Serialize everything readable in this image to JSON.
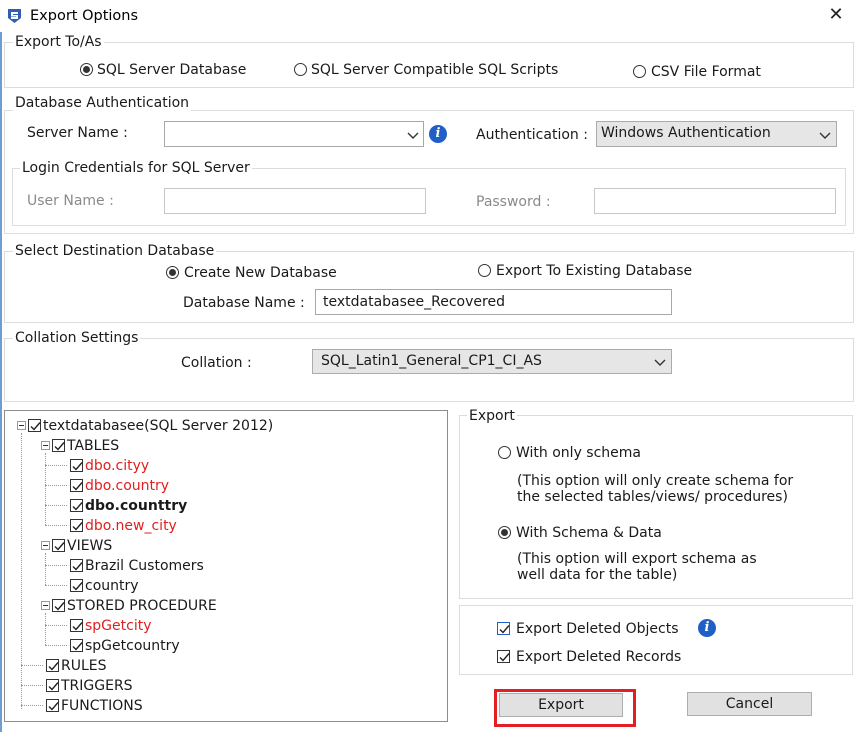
{
  "window": {
    "title": "Export Options"
  },
  "export_to": {
    "legend": "Export To/As",
    "options": [
      "SQL Server Database",
      "SQL Server Compatible SQL Scripts",
      "CSV File Format"
    ],
    "selected": 0
  },
  "auth": {
    "legend": "Database Authentication",
    "server_name_label": "Server Name :",
    "server_name_value": "",
    "authentication_label": "Authentication :",
    "authentication_value": "Windows Authentication",
    "login": {
      "legend": "Login Credentials for SQL Server",
      "user_name_label": "User Name :",
      "password_label": "Password :"
    }
  },
  "destination": {
    "legend": "Select Destination Database",
    "options": [
      "Create New Database",
      "Export To Existing Database"
    ],
    "selected": 0,
    "db_name_label": "Database Name :",
    "db_name_value": "textdatabasee_Recovered"
  },
  "collation": {
    "legend": "Collation Settings",
    "label": "Collation :",
    "value": "SQL_Latin1_General_CP1_CI_AS"
  },
  "tree": {
    "root": "textdatabasee(SQL Server 2012)",
    "tables": "TABLES",
    "table_items": [
      "dbo.cityy",
      "dbo.country",
      "dbo.counttry",
      "dbo.new_city"
    ],
    "views": "VIEWS",
    "view_items": [
      "Brazil Customers",
      "country"
    ],
    "procs": "STORED PROCEDURE",
    "proc_items": [
      "spGetcity",
      "spGetcountry"
    ],
    "rules": "RULES",
    "triggers": "TRIGGERS",
    "functions": "FUNCTIONS",
    "highlight_color": "#e02020"
  },
  "export_panel": {
    "legend": "Export",
    "schema_only": "With only schema",
    "schema_only_desc1": "(This option will only create schema for",
    "schema_only_desc2": "the  selected tables/views/ procedures)",
    "schema_data": "With Schema & Data",
    "schema_data_desc1": "(This option will export schema as",
    "schema_data_desc2": "well data for the table)",
    "selected": "schema_data"
  },
  "deleted": {
    "objects": "Export Deleted Objects",
    "records": "Export Deleted Records"
  },
  "buttons": {
    "export": "Export",
    "cancel": "Cancel"
  },
  "colors": {
    "accent_info": "#1f5fc6",
    "highlight_box": "#e31e24"
  }
}
